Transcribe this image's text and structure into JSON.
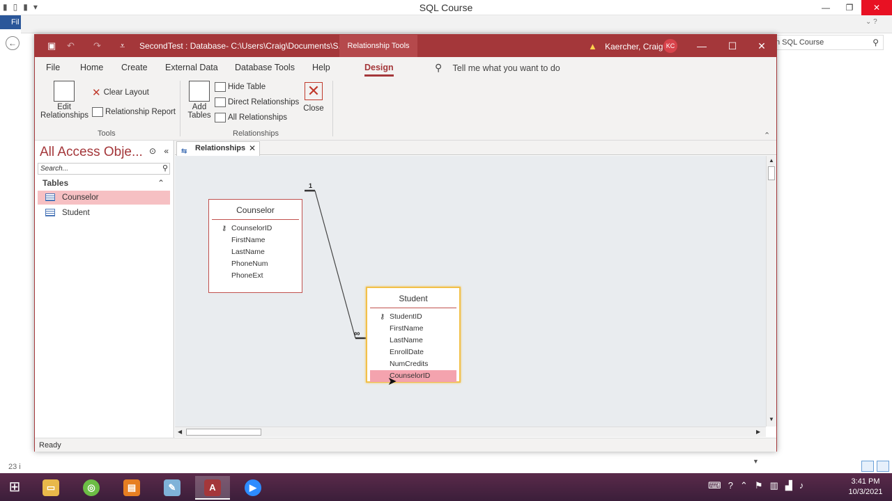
{
  "background": {
    "window_title": "SQL Course",
    "file_tab": "Fil",
    "search_value": "n SQL Course",
    "left_number": "23 i"
  },
  "window": {
    "title": "SecondTest : Database- C:\\Users\\Craig\\Documents\\S...",
    "context_tab": "Relationship Tools",
    "user_name": "Kaercher, Craig",
    "user_initials": "KC",
    "accent_color": "#a4373a"
  },
  "menu": {
    "tabs": [
      "File",
      "Home",
      "Create",
      "External Data",
      "Database Tools",
      "Help",
      "Design"
    ],
    "active_tab": "Design",
    "tell_me": "Tell me what you want to do"
  },
  "ribbon": {
    "tools": {
      "edit_relationships": [
        "Edit",
        "Relationships"
      ],
      "clear_layout": "Clear Layout",
      "relationship_report": "Relationship Report",
      "label": "Tools"
    },
    "relationships": {
      "add_tables": [
        "Add",
        "Tables"
      ],
      "hide_table": "Hide Table",
      "direct_relationships": "Direct Relationships",
      "all_relationships": "All Relationships",
      "close": "Close",
      "label": "Relationships"
    }
  },
  "nav": {
    "title": "All Access Obje...",
    "search_placeholder": "Search...",
    "section": "Tables",
    "items": [
      {
        "label": "Counselor",
        "selected": true
      },
      {
        "label": "Student",
        "selected": false
      }
    ]
  },
  "document": {
    "tab_label": "Relationships"
  },
  "tables": [
    {
      "name": "Counselor",
      "fields": [
        "CounselorID",
        "FirstName",
        "LastName",
        "PhoneNum",
        "PhoneExt"
      ],
      "primary_key": "CounselorID"
    },
    {
      "name": "Student",
      "fields": [
        "StudentID",
        "FirstName",
        "LastName",
        "EnrollDate",
        "NumCredits",
        "CounselorID"
      ],
      "primary_key": "StudentID",
      "highlighted_field": "CounselorID"
    }
  ],
  "relationship": {
    "one_side": "1",
    "many_side": "∞"
  },
  "status": "Ready",
  "taskbar": {
    "time": "3:41 PM",
    "date": "10/3/2021"
  }
}
